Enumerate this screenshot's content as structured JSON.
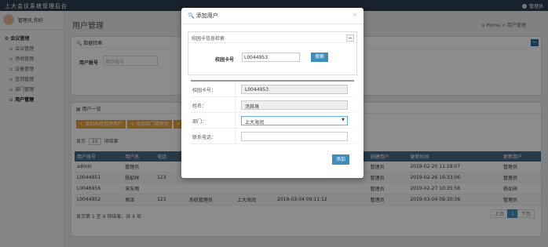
{
  "header": {
    "brand": "上大会议系统管理后台",
    "user": "管理员"
  },
  "sidebar": {
    "user_name": "管理员,你好",
    "group": "会议管理",
    "items": [
      {
        "label": "会议管理"
      },
      {
        "label": "场地管理"
      },
      {
        "label": "设备管理"
      },
      {
        "label": "签到管理"
      },
      {
        "label": "部门管理"
      },
      {
        "label": "用户管理"
      }
    ]
  },
  "main": {
    "title": "用户管理",
    "breadcrumb": {
      "home": "Home",
      "current": "用户管理"
    },
    "search_panel": {
      "title": "数据检索",
      "label": "用户账号",
      "placeholder": "用户账号"
    },
    "list_panel": {
      "title": "用户一览",
      "buttons": [
        "添加系统管理用户",
        "添加部门管理员",
        ""
      ],
      "show_prefix": "显示",
      "page_size": "10",
      "show_suffix": "项结果",
      "columns": [
        "用户账号",
        "用户名",
        "电话",
        "",
        "",
        "",
        "",
        "创建用户",
        "更新时间",
        "更新用户"
      ],
      "rows": [
        [
          "admin",
          "管理员",
          "",
          "",
          "",
          "",
          "",
          "管理员",
          "2019-02-20 11:18:07",
          "管理员"
        ],
        [
          "L0044951",
          "杨如祥",
          "123",
          "",
          "",
          "",
          "",
          "管理员",
          "2019-02-26 16:33:06",
          "管理员"
        ],
        [
          "L0046956",
          "宋东雨",
          "",
          "",
          "",
          "",
          "",
          "管理员",
          "2019-02-27 10:35:58",
          "杨如祥"
        ],
        [
          "L0044952",
          "郭泽",
          "123",
          "",
          "系统管理员",
          "上大海润",
          "2019-03-04 09:11:12",
          "管理员",
          "2019-03-04 09:30:39",
          "管理员"
        ]
      ],
      "footer": "显示第 1 至 4 项结果，共 4 项",
      "pager": {
        "prev": "上页",
        "current": "1",
        "next": "下页"
      }
    }
  },
  "modal": {
    "title": "添加用户",
    "search_section": {
      "title": "校园卡信息检索",
      "label": "校园卡号",
      "value": "L0044953",
      "button": "搜索"
    },
    "form": {
      "fields": [
        {
          "label": "校园卡号：",
          "value": "L0044953"
        },
        {
          "label": "姓名：",
          "value": "汤其境"
        },
        {
          "label": "部门：",
          "value": "上大海润"
        },
        {
          "label": "联系电话：",
          "value": ""
        }
      ]
    },
    "add_button": "添加"
  }
}
